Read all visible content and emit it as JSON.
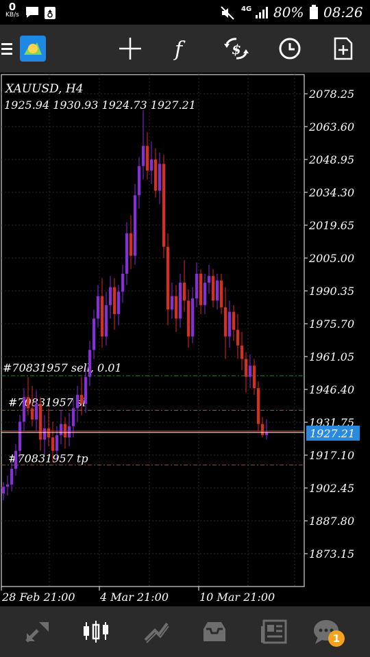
{
  "status_bar": {
    "kbps_value": "0",
    "kbps_unit": "KB/s",
    "network_label": "4G",
    "battery": "80%",
    "time": "08:26"
  },
  "toolbar": {
    "icons": [
      "menu-icon",
      "metatrader-logo-icon",
      "crosshair-icon",
      "function-icon",
      "trade-icon",
      "clock-icon",
      "new-order-icon"
    ]
  },
  "chart": {
    "symbol_line": "XAUUSD, H4",
    "ohlc_line": "1925.94 1930.93 1924.73 1927.21",
    "current_price": "1927.21",
    "order_lines": [
      {
        "label": "#70831957 sell, 0.01",
        "price": 1952.5,
        "color": "#1f8f1f"
      },
      {
        "label": "#70831957 sl",
        "price": 1937.1,
        "color": "#d33a2a"
      },
      {
        "label": "#70831957 tp",
        "price": 1912.7,
        "color": "#d33a2a"
      }
    ],
    "colors": {
      "bull": "#8a2be2",
      "bear": "#e02a1a",
      "grid": "#2a2a2a",
      "price_badge": "#2a8ae0"
    }
  },
  "chart_data": {
    "type": "candlestick",
    "symbol": "XAUUSD",
    "timeframe": "H4",
    "y_ticks": [
      2078.25,
      2063.6,
      2048.95,
      2034.3,
      2019.65,
      2005.0,
      1990.35,
      1975.7,
      1961.05,
      1946.4,
      1931.75,
      1917.1,
      1902.45,
      1887.8,
      1873.15
    ],
    "y_tick_labels": [
      "2078.25",
      "2063.60",
      "2048.95",
      "2034.30",
      "2019.65",
      "2005.00",
      "1990.35",
      "1975.70",
      "1961.05",
      "1946.40",
      "1931.75",
      "1917.10",
      "1902.45",
      "1887.80",
      "1873.15"
    ],
    "x_labels": [
      "28 Feb 21:00",
      "4 Mar 21:00",
      "10 Mar 21:00"
    ],
    "candles": [
      [
        1900,
        1905,
        1897,
        1903
      ],
      [
        1903,
        1908,
        1899,
        1904
      ],
      [
        1904,
        1914,
        1901,
        1911
      ],
      [
        1911,
        1922,
        1908,
        1919
      ],
      [
        1919,
        1935,
        1915,
        1932
      ],
      [
        1932,
        1947,
        1928,
        1943
      ],
      [
        1943,
        1952,
        1935,
        1938
      ],
      [
        1938,
        1948,
        1930,
        1933
      ],
      [
        1933,
        1946,
        1928,
        1940
      ],
      [
        1940,
        1943,
        1919,
        1924
      ],
      [
        1924,
        1935,
        1917,
        1929
      ],
      [
        1929,
        1938,
        1921,
        1925
      ],
      [
        1925,
        1932,
        1914,
        1919
      ],
      [
        1919,
        1930,
        1915,
        1926
      ],
      [
        1926,
        1937,
        1922,
        1931
      ],
      [
        1931,
        1934,
        1920,
        1925
      ],
      [
        1925,
        1936,
        1921,
        1930
      ],
      [
        1930,
        1942,
        1925,
        1938
      ],
      [
        1938,
        1948,
        1932,
        1944
      ],
      [
        1944,
        1952,
        1935,
        1940
      ],
      [
        1940,
        1956,
        1936,
        1952
      ],
      [
        1952,
        1968,
        1948,
        1964
      ],
      [
        1964,
        1982,
        1960,
        1978
      ],
      [
        1978,
        1993,
        1974,
        1988
      ],
      [
        1988,
        1996,
        1965,
        1970
      ],
      [
        1970,
        1990,
        1966,
        1984
      ],
      [
        1984,
        1997,
        1978,
        1992
      ],
      [
        1992,
        1996,
        1973,
        1980
      ],
      [
        1980,
        1993,
        1975,
        1990
      ],
      [
        1990,
        2002,
        1985,
        1998
      ],
      [
        1998,
        2021,
        1993,
        2016
      ],
      [
        2016,
        2024,
        2000,
        2006
      ],
      [
        2006,
        2038,
        2002,
        2033
      ],
      [
        2033,
        2050,
        2027,
        2046
      ],
      [
        2046,
        2071,
        2040,
        2055
      ],
      [
        2055,
        2061,
        2040,
        2044
      ],
      [
        2044,
        2057,
        2038,
        2049
      ],
      [
        2049,
        2054,
        2032,
        2035
      ],
      [
        2035,
        2052,
        2029,
        2047
      ],
      [
        2047,
        2051,
        2005,
        2010
      ],
      [
        2010,
        2016,
        1975,
        1982
      ],
      [
        1982,
        1994,
        1978,
        1988
      ],
      [
        1988,
        1993,
        1972,
        1978
      ],
      [
        1978,
        1998,
        1974,
        1994
      ],
      [
        1994,
        2004,
        1981,
        1986
      ],
      [
        1986,
        1991,
        1965,
        1970
      ],
      [
        1970,
        1992,
        1967,
        1987
      ],
      [
        1987,
        2003,
        1983,
        1998
      ],
      [
        1998,
        2000,
        1980,
        1984
      ],
      [
        1984,
        1998,
        1980,
        1994
      ],
      [
        1994,
        2002,
        1989,
        1997
      ],
      [
        1997,
        2000,
        1983,
        1986
      ],
      [
        1986,
        1998,
        1982,
        1995
      ],
      [
        1995,
        1998,
        1980,
        1983
      ],
      [
        1983,
        1992,
        1960,
        1970
      ],
      [
        1970,
        1986,
        1965,
        1981
      ],
      [
        1981,
        1984,
        1968,
        1973
      ],
      [
        1973,
        1980,
        1960,
        1966
      ],
      [
        1966,
        1972,
        1955,
        1960
      ],
      [
        1960,
        1963,
        1945,
        1952
      ],
      [
        1952,
        1962,
        1947,
        1957
      ],
      [
        1957,
        1960,
        1944,
        1947
      ],
      [
        1947,
        1950,
        1928,
        1931
      ],
      [
        1931,
        1934,
        1925,
        1926
      ],
      [
        1926,
        1933,
        1924,
        1927
      ]
    ]
  },
  "bottom_nav": {
    "items": [
      "quotes-icon",
      "chart-icon",
      "trade-icon",
      "history-icon",
      "news-icon",
      "chat-icon"
    ],
    "chat_badge": "1"
  }
}
